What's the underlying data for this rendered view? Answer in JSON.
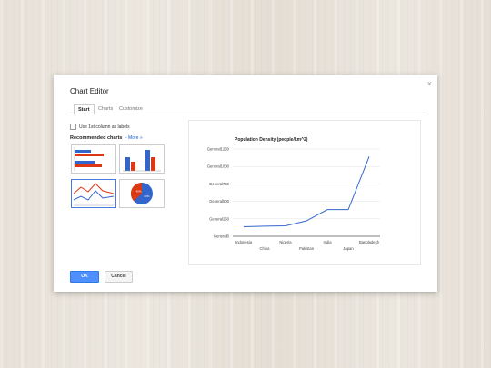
{
  "dialog": {
    "title": "Chart Editor",
    "close": "×",
    "tabs": [
      {
        "label": "Start",
        "active": true
      },
      {
        "label": "Charts",
        "active": false
      },
      {
        "label": "Customize",
        "active": false
      }
    ],
    "checkbox_label": "Use 1st column as labels",
    "recommended_label": "Recommended charts",
    "more_label": "- More »",
    "ok_label": "OK",
    "cancel_label": "Cancel"
  },
  "thumbnails": [
    {
      "name": "bar-chart-thumb",
      "selected": false
    },
    {
      "name": "column-chart-thumb",
      "selected": false
    },
    {
      "name": "line-chart-thumb",
      "selected": true
    },
    {
      "name": "pie-chart-thumb",
      "selected": false,
      "labels": [
        "40%",
        "60%"
      ]
    }
  ],
  "colors": {
    "blue": "#3366cc",
    "red": "#dc3912",
    "primary": "#4d90fe"
  },
  "chart_data": {
    "type": "line",
    "title": "Population Density (people/km^2)",
    "categories": [
      "Indonesia",
      "China",
      "Nigeria",
      "Pakistan",
      "India",
      "Japan",
      "Bangladesh"
    ],
    "values": [
      136,
      145,
      150,
      221,
      382,
      382,
      1142
    ],
    "ylim": [
      0,
      1250
    ],
    "yticks": [
      "General0",
      "General250",
      "General500",
      "General750",
      "General1000",
      "General1250"
    ],
    "ytick_values": [
      0,
      250,
      500,
      750,
      1000,
      1250
    ],
    "line_color": "#3366cc",
    "grid": true,
    "legend": "none"
  }
}
